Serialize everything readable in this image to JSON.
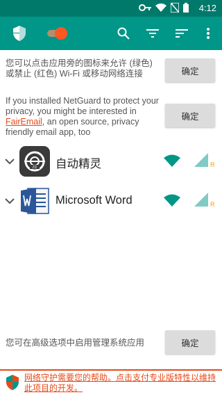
{
  "status_bar": {
    "time": "4:12"
  },
  "toolbar": {
    "icons": [
      "shield-icon",
      "toggle-switch",
      "search-icon",
      "filter-icon",
      "sort-icon",
      "overflow-menu-icon"
    ],
    "colors": {
      "bar": "#009688",
      "status": "#00796b",
      "toggle_on": "#ff5722"
    }
  },
  "hints": [
    {
      "text": "您可以点击应用旁的图标来允许 (绿色) 或禁止 (红色) Wi-Fi 或移动网络连接",
      "button": "确定"
    },
    {
      "text_before": "If you installed NetGuard to protect your privacy, you might be interested in ",
      "link": "FairEmail",
      "text_after": ", an open source, privacy friendly email app, too",
      "button": "确定"
    }
  ],
  "apps": [
    {
      "name": "自动精灵",
      "icon": "zidong-jingling-icon",
      "wifi": "allowed",
      "mobile": "allowed",
      "roaming_label": "R"
    },
    {
      "name": "Microsoft Word",
      "icon": "microsoft-word-icon",
      "wifi": "allowed",
      "mobile": "allowed",
      "roaming_label": "R"
    }
  ],
  "bottom_hint": {
    "text": "您可在高级选项中启用管理系统应用",
    "button": "确定"
  },
  "footer": {
    "text": "网络守护需要您的帮助。点击支付专业版特性以维持此项目的开发。"
  }
}
